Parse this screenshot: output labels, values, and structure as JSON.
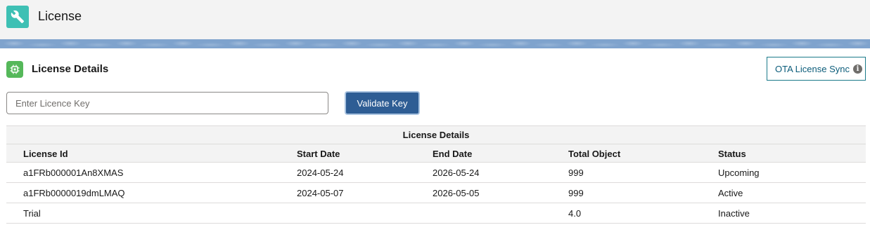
{
  "header": {
    "title": "License",
    "icon": "wrench-icon"
  },
  "card": {
    "title": "License Details",
    "icon": "chip-icon"
  },
  "actions": {
    "ota_sync_label": "OTA License Sync",
    "validate_label": "Validate Key"
  },
  "key_input": {
    "placeholder": "Enter Licence Key",
    "value": ""
  },
  "table": {
    "caption": "License Details",
    "columns": [
      "License Id",
      "Start Date",
      "End Date",
      "Total Object",
      "Status"
    ],
    "rows": [
      [
        "a1FRb000001An8XMAS",
        "2024-05-24",
        "2026-05-24",
        "999",
        "Upcoming"
      ],
      [
        "a1FRb0000019dmLMAQ",
        "2024-05-07",
        "2026-05-05",
        "999",
        "Active"
      ],
      [
        "Trial",
        "",
        "",
        "4.0",
        "Inactive"
      ]
    ]
  },
  "colors": {
    "header_bg": "#f3f3f3",
    "app_icon": "#3ec0b4",
    "card_icon": "#55b85a",
    "brand_button": "#2e5d94",
    "outline_button": "#1b7a8a",
    "band": "#7fa3cd"
  }
}
